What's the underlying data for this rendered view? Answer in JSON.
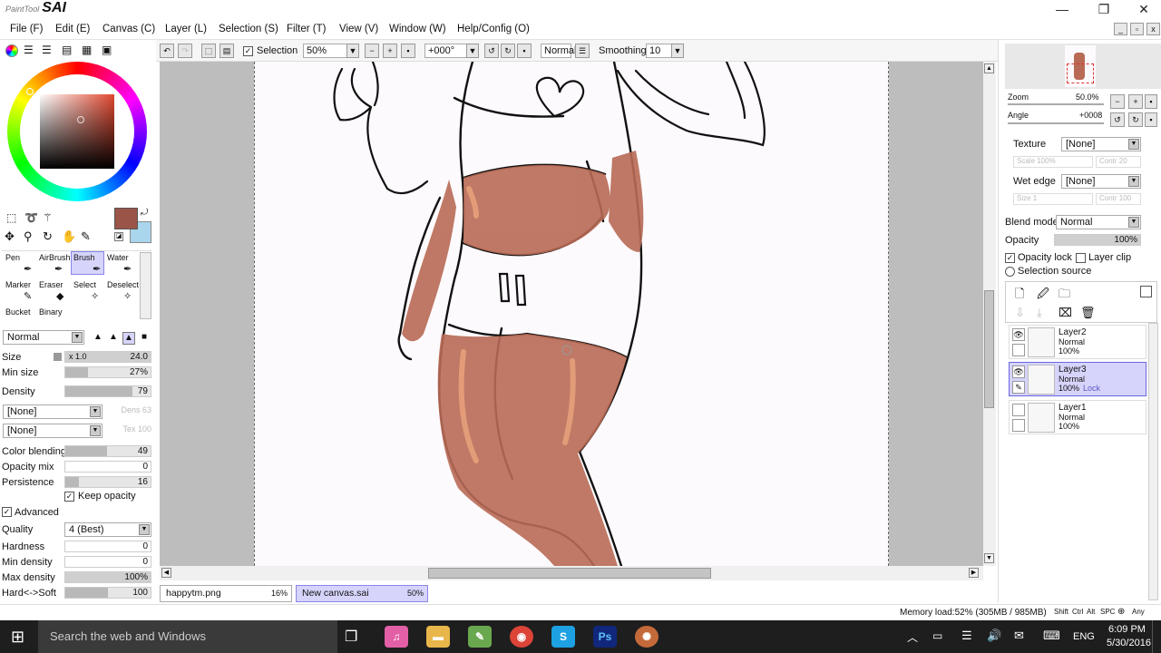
{
  "app": {
    "logo_small": "PaintTool",
    "logo_big": "SAI"
  },
  "window": {
    "minimize": "—",
    "restore": "❐",
    "close": "✕"
  },
  "menu": [
    "File (F)",
    "Edit (E)",
    "Canvas (C)",
    "Layer (L)",
    "Selection (S)",
    "Filter (T)",
    "View (V)",
    "Window (W)",
    "Help/Config (O)"
  ],
  "toolbar": {
    "selection_label": "Selection",
    "zoom": "50%",
    "angle": "+000°",
    "mode": "Normal",
    "smoothing_label": "Smoothing",
    "smoothing_value": "10"
  },
  "colors": {
    "primary": "#9a5548",
    "secondary": "#a9d6ec",
    "skin": "#b86a55",
    "canvas": "#fdfafd",
    "selected_layer": "#d6d4fa"
  },
  "tools": {
    "row1": [
      "Pen",
      "AirBrush",
      "Brush",
      "Water"
    ],
    "row2": [
      "Marker",
      "Eraser",
      "Select",
      "Deselect"
    ],
    "row3": [
      "Bucket",
      "Binary"
    ],
    "selected": "Brush"
  },
  "brush": {
    "blend_mode": "Normal",
    "size_label": "Size",
    "size_mult": "x 1.0",
    "size_value": "24.0",
    "min_size_label": "Min size",
    "min_size_value": "27%",
    "min_size_pct": 27,
    "density_label": "Density",
    "density_value": "79",
    "density_pct": 79,
    "shape_1": "[None]",
    "shape_1_param": "Dens 63",
    "texture_1": "[None]",
    "texture_1_param": "Tex 100",
    "color_blending_label": "Color blending",
    "color_blending_value": "49",
    "color_blending_pct": 49,
    "opacity_mix_label": "Opacity mix",
    "opacity_mix_value": "0",
    "persistence_label": "Persistence",
    "persistence_value": "16",
    "persistence_pct": 16,
    "keep_opacity_label": "Keep opacity",
    "advanced_label": "Advanced",
    "quality_label": "Quality",
    "quality_value": "4 (Best)",
    "hardness_label": "Hardness",
    "hardness_value": "0",
    "min_density_label": "Min density",
    "min_density_value": "0",
    "max_density_label": "Max density",
    "max_density_value": "100%",
    "hard_soft_label": "Hard<->Soft",
    "hard_soft_value": "100",
    "hard_soft_pct": 50
  },
  "navigator": {
    "zoom_label": "Zoom",
    "zoom_value": "50.0%",
    "angle_label": "Angle",
    "angle_value": "+0008"
  },
  "layer_props": {
    "texture_label": "Texture",
    "texture_value": "[None]",
    "texture_params": [
      "Scale 100%",
      "Contr 20"
    ],
    "wet_edge_label": "Wet edge",
    "wet_edge_value": "[None]",
    "wet_edge_params": [
      "Size 1",
      "Contr 100"
    ],
    "blend_mode_label": "Blend mode",
    "blend_mode_value": "Normal",
    "opacity_label": "Opacity",
    "opacity_value": "100%",
    "opacity_lock_label": "Opacity lock",
    "layer_clip_label": "Layer clip",
    "selection_source_label": "Selection source"
  },
  "layers": [
    {
      "name": "Layer2",
      "mode": "Normal",
      "opacity": "100%",
      "lock": "",
      "visible": true,
      "selected": false
    },
    {
      "name": "Layer3",
      "mode": "Normal",
      "opacity": "100%",
      "lock": "Lock",
      "visible": true,
      "selected": true
    },
    {
      "name": "Layer1",
      "mode": "Normal",
      "opacity": "100%",
      "lock": "",
      "visible": false,
      "selected": false
    }
  ],
  "doc_tabs": [
    {
      "name": "happytm.png",
      "zoom": "16%"
    },
    {
      "name": "New canvas.sai",
      "zoom": "50%"
    }
  ],
  "status": {
    "memory": "Memory load:52% (305MB / 985MB)",
    "keys": [
      "Shift",
      "Ctrl",
      "Alt",
      "SPC",
      "Any"
    ]
  },
  "taskbar": {
    "search_placeholder": "Search the web and Windows",
    "tray_lang": "ENG",
    "time": "6:09 PM",
    "date": "5/30/2016"
  }
}
